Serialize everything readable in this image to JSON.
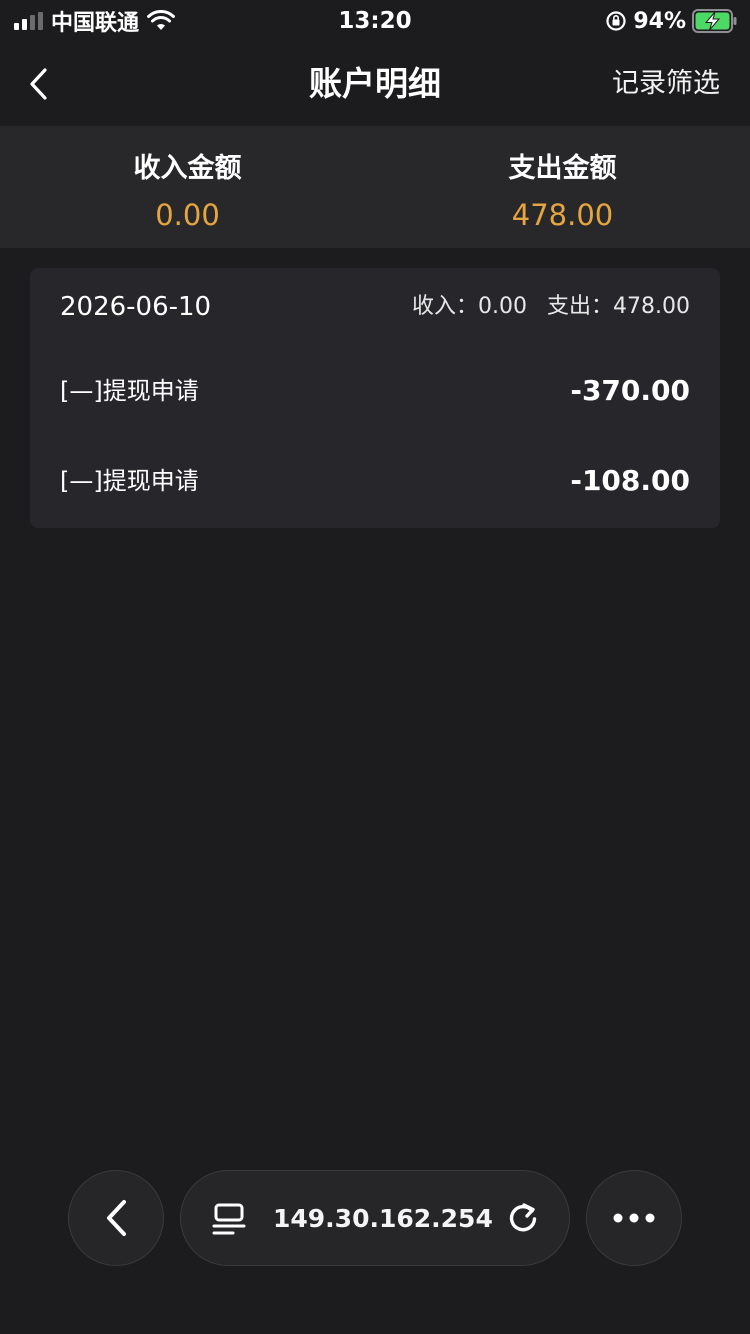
{
  "status_bar": {
    "carrier": "中国联通",
    "time": "13:20",
    "battery": "94%"
  },
  "nav": {
    "title": "账户明细",
    "filter": "记录筛选",
    "back_icon": "chevron-left-icon"
  },
  "summary": {
    "income_label": "收入金额",
    "income_value": "0.00",
    "expense_label": "支出金额",
    "expense_value": "478.00",
    "value_color": "#e5a53f"
  },
  "records": {
    "date": "2026-06-10",
    "income_text": "收入：0.00",
    "expense_text": "支出：478.00",
    "items": [
      {
        "title": "[—]提现申请",
        "amount": "-370.00"
      },
      {
        "title": "[—]提现申请",
        "amount": "-108.00"
      }
    ]
  },
  "browser_bar": {
    "address": "149.30.162.254",
    "icons": [
      "chevron-left-icon",
      "reader-icon",
      "reload-icon",
      "more-icon"
    ]
  }
}
